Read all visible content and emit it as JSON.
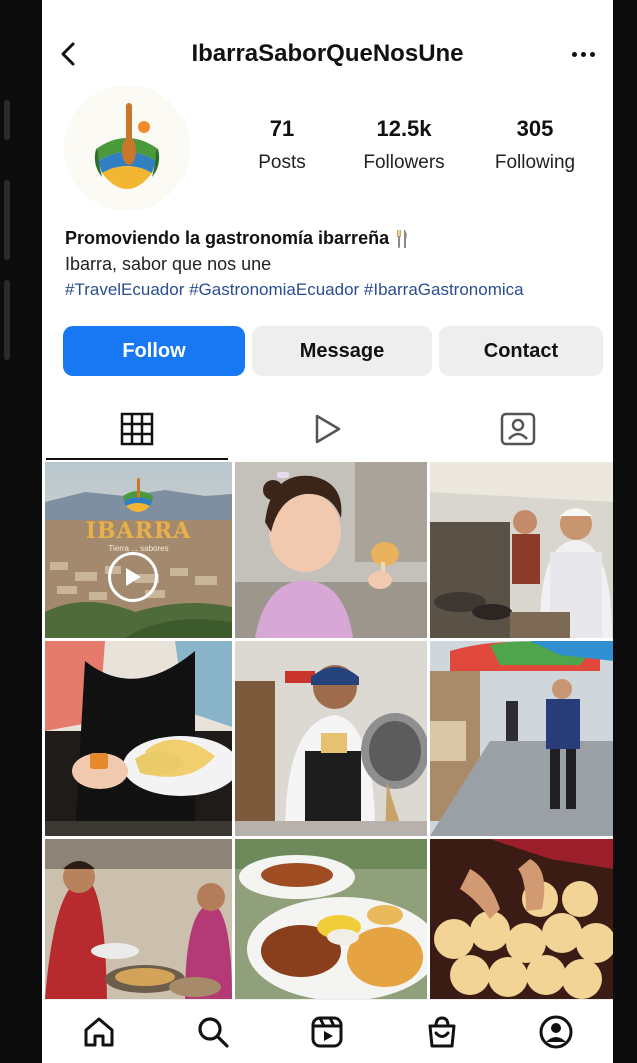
{
  "header": {
    "handle": "IbarraSaborQueNosUne"
  },
  "profile": {
    "stats": [
      {
        "value": "71",
        "label": "Posts"
      },
      {
        "value": "12.5k",
        "label": "Followers"
      },
      {
        "value": "305",
        "label": "Following"
      }
    ],
    "bio_name": "Promoviendo la gastronomía ibarreña",
    "bio_line": "Ibarra, sabor que nos une",
    "bio_tags": "#TravelEcuador #GastronomiaEcuador #IbarraGastronomica"
  },
  "actions": {
    "follow": "Follow",
    "message": "Message",
    "contact": "Contact"
  },
  "tabs": [
    {
      "icon": "grid-icon",
      "active": true
    },
    {
      "icon": "reels-play-icon",
      "active": false
    },
    {
      "icon": "tagged-person-icon",
      "active": false
    }
  ],
  "posts": {
    "video_title": "IBARRA",
    "video_subtitle": "Tierra ... sabores"
  },
  "colors": {
    "accent": "#1877f2",
    "hashtag": "#2a4d8f"
  },
  "bottom_nav": [
    "home-icon",
    "search-icon",
    "reels-icon",
    "shop-icon",
    "profile-icon"
  ]
}
